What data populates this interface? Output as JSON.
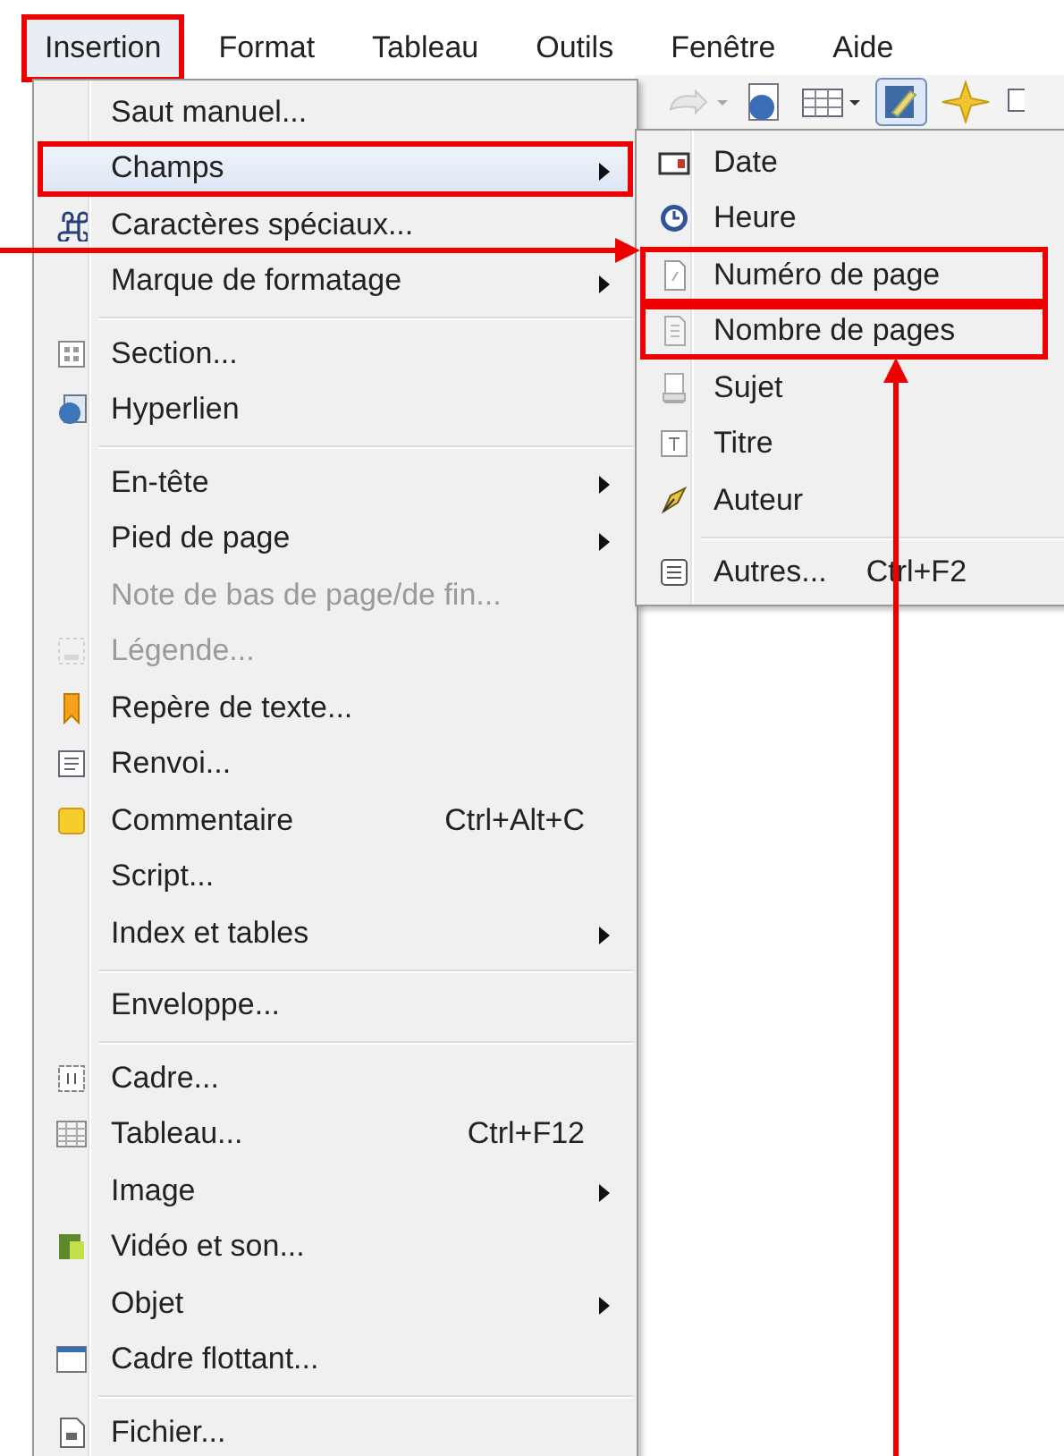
{
  "menubar": [
    {
      "label": "Insertion",
      "selected": true,
      "highlighted": true
    },
    {
      "label": "Format",
      "selected": false,
      "highlighted": false
    },
    {
      "label": "Tableau",
      "selected": false,
      "highlighted": false
    },
    {
      "label": "Outils",
      "selected": false,
      "highlighted": false
    },
    {
      "label": "Fenêtre",
      "selected": false,
      "highlighted": false
    },
    {
      "label": "Aide",
      "selected": false,
      "highlighted": false
    }
  ],
  "menu": [
    {
      "kind": "item",
      "label": "Saut manuel...",
      "selected": false,
      "disabled": false,
      "submenu": false
    },
    {
      "kind": "item",
      "label": "Champs",
      "selected": true,
      "disabled": false,
      "submenu": true,
      "highlighted": true
    },
    {
      "kind": "item",
      "label": "Caractères spéciaux...",
      "selected": false,
      "disabled": false,
      "submenu": false
    },
    {
      "kind": "item",
      "label": "Marque de formatage",
      "selected": false,
      "disabled": false,
      "submenu": true
    },
    {
      "kind": "separator"
    },
    {
      "kind": "item",
      "label": "Section...",
      "selected": false,
      "disabled": false,
      "submenu": false
    },
    {
      "kind": "item",
      "label": "Hyperlien",
      "selected": false,
      "disabled": false,
      "submenu": false
    },
    {
      "kind": "separator"
    },
    {
      "kind": "item",
      "label": "En-tête",
      "selected": false,
      "disabled": false,
      "submenu": true
    },
    {
      "kind": "item",
      "label": "Pied de page",
      "selected": false,
      "disabled": false,
      "submenu": true
    },
    {
      "kind": "item",
      "label": "Note de bas de page/de fin...",
      "selected": false,
      "disabled": true,
      "submenu": false
    },
    {
      "kind": "item",
      "label": "Légende...",
      "selected": false,
      "disabled": true,
      "submenu": false
    },
    {
      "kind": "item",
      "label": "Repère de texte...",
      "selected": false,
      "disabled": false,
      "submenu": false
    },
    {
      "kind": "item",
      "label": "Renvoi...",
      "selected": false,
      "disabled": false,
      "submenu": false
    },
    {
      "kind": "item",
      "label": "Commentaire",
      "shortcut": "Ctrl+Alt+C",
      "selected": false,
      "disabled": false,
      "submenu": false
    },
    {
      "kind": "item",
      "label": "Script...",
      "selected": false,
      "disabled": false,
      "submenu": false
    },
    {
      "kind": "item",
      "label": "Index et tables",
      "selected": false,
      "disabled": false,
      "submenu": true
    },
    {
      "kind": "separator"
    },
    {
      "kind": "item",
      "label": "Enveloppe...",
      "selected": false,
      "disabled": false,
      "submenu": false
    },
    {
      "kind": "separator"
    },
    {
      "kind": "item",
      "label": "Cadre...",
      "selected": false,
      "disabled": false,
      "submenu": false
    },
    {
      "kind": "item",
      "label": "Tableau...",
      "shortcut": "Ctrl+F12",
      "selected": false,
      "disabled": false,
      "submenu": false
    },
    {
      "kind": "item",
      "label": "Image",
      "selected": false,
      "disabled": false,
      "submenu": true
    },
    {
      "kind": "item",
      "label": "Vidéo et son...",
      "selected": false,
      "disabled": false,
      "submenu": false
    },
    {
      "kind": "item",
      "label": "Objet",
      "selected": false,
      "disabled": false,
      "submenu": true
    },
    {
      "kind": "item",
      "label": "Cadre flottant...",
      "selected": false,
      "disabled": false,
      "submenu": false
    },
    {
      "kind": "separator"
    },
    {
      "kind": "item",
      "label": "Fichier...",
      "selected": false,
      "disabled": false,
      "submenu": false
    }
  ],
  "submenu": [
    {
      "kind": "item",
      "label": "Date"
    },
    {
      "kind": "item",
      "label": "Heure"
    },
    {
      "kind": "item",
      "label": "Numéro de page",
      "highlighted": true,
      "arrow_left": true,
      "arrow_below": false
    },
    {
      "kind": "item",
      "label": "Nombre de pages",
      "highlighted": true,
      "arrow_left": false,
      "arrow_below": true
    },
    {
      "kind": "item",
      "label": "Sujet"
    },
    {
      "kind": "item",
      "label": "Titre"
    },
    {
      "kind": "item",
      "label": "Auteur"
    },
    {
      "kind": "separator"
    },
    {
      "kind": "item",
      "label": "Autres...",
      "shortcut": "Ctrl+F2"
    }
  ]
}
